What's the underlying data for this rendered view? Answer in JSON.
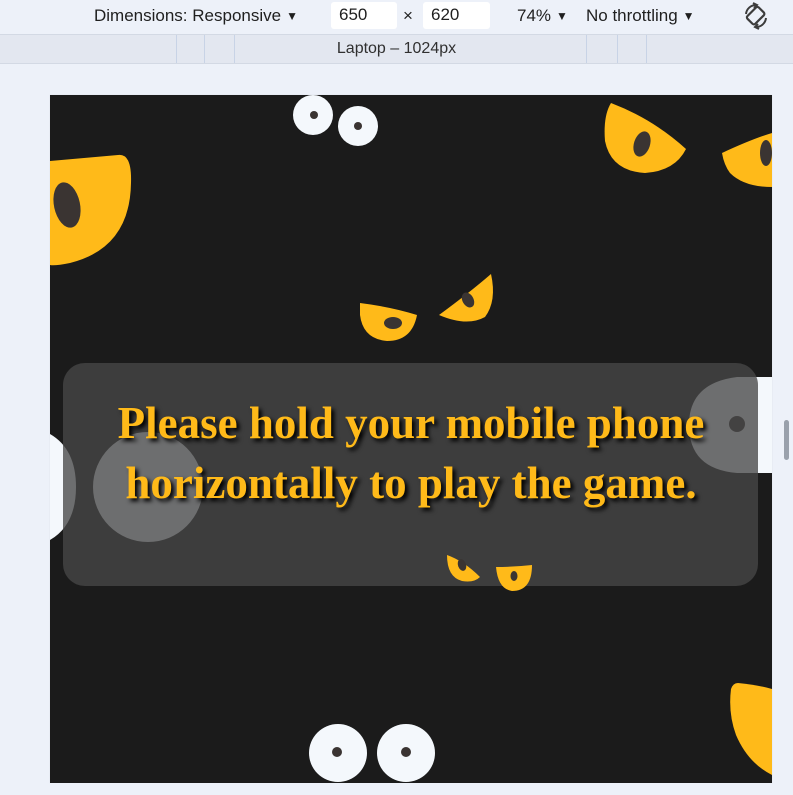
{
  "devtools": {
    "dimensions_label": "Dimensions: Responsive",
    "width_value": "650",
    "times_symbol": "×",
    "height_value": "620",
    "zoom_label": "74%",
    "throttling_label": "No throttling",
    "rotate_icon": "rotate-icon",
    "media_query_label": "Laptop – 1024px"
  },
  "game": {
    "message": "Please hold your mobile phone horizontally to play the game."
  },
  "colors": {
    "background": "#1b1b1b",
    "eye_yellow": "#ffba19",
    "eye_white": "#f4f8fc",
    "pupil": "#3a3432",
    "modal": "#464646"
  }
}
